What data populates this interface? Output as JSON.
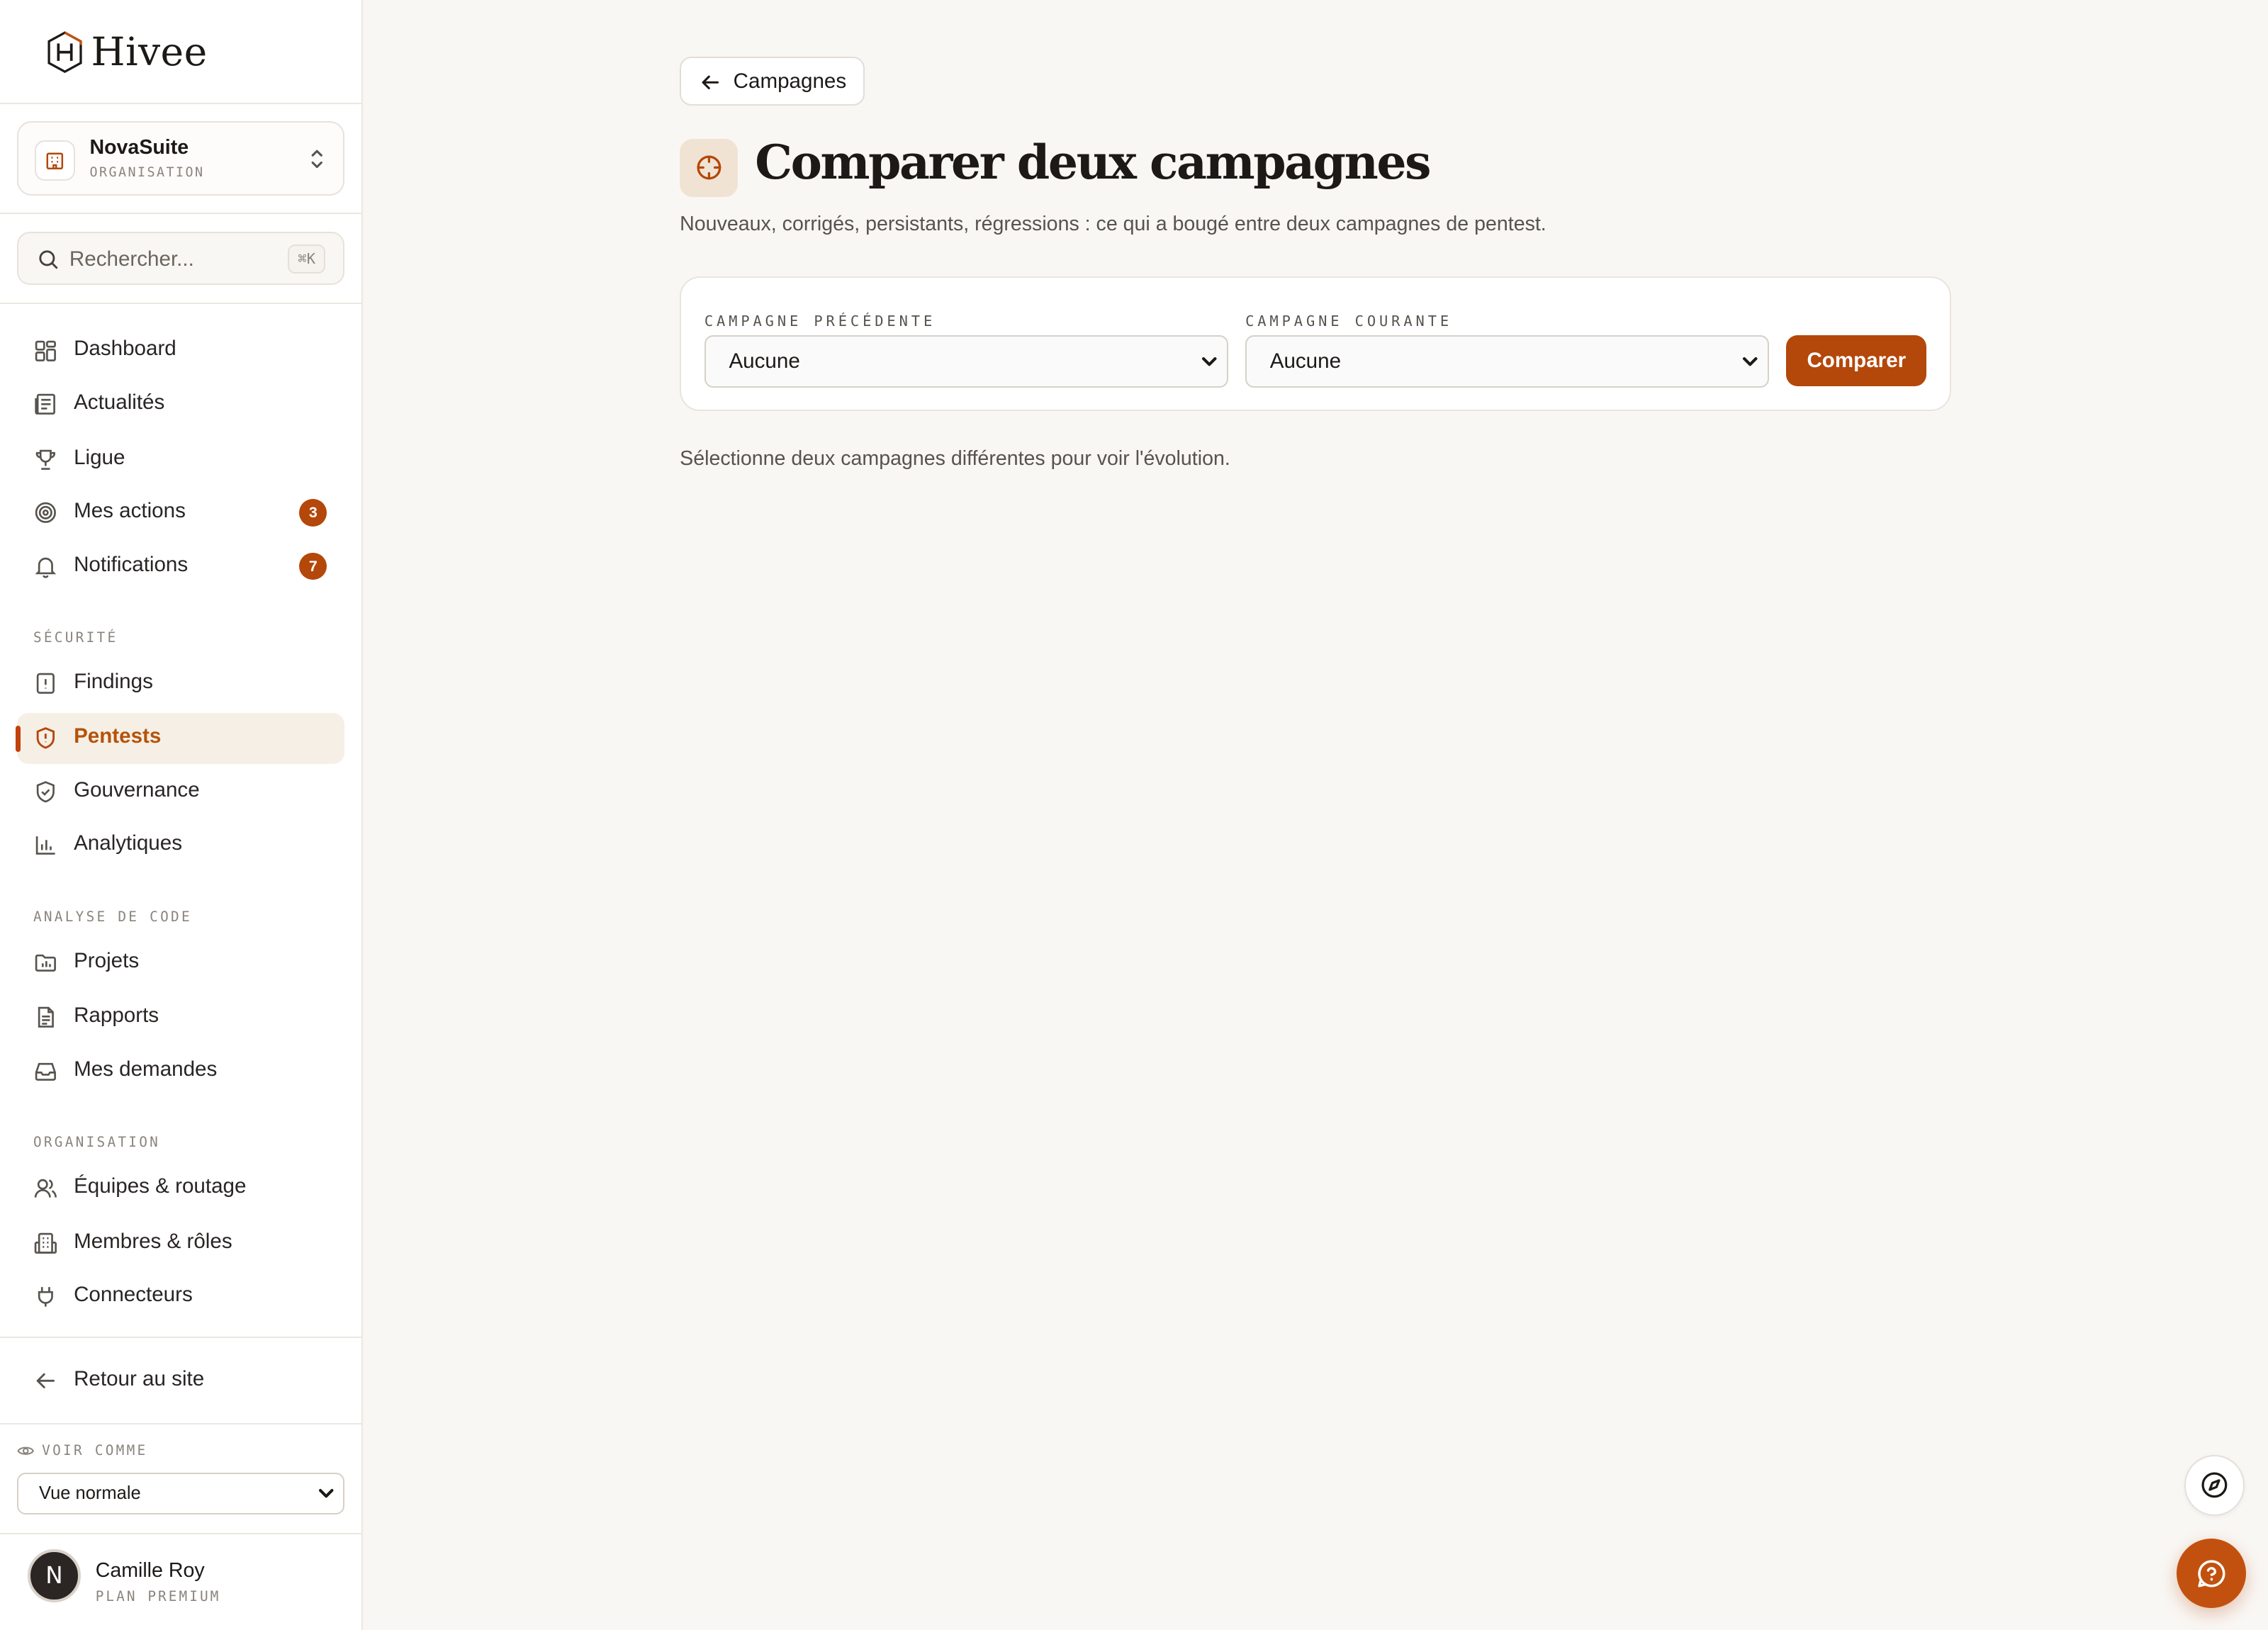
{
  "brand": {
    "name": "Hivee",
    "accent": "#b4470a"
  },
  "org": {
    "name": "NovaSuite",
    "type": "ORGANISATION"
  },
  "search": {
    "placeholder": "Rechercher...",
    "shortcut": "⌘K"
  },
  "nav": {
    "main": [
      {
        "label": "Dashboard",
        "icon": "dashboard-icon"
      },
      {
        "label": "Actualités",
        "icon": "newspaper-icon"
      },
      {
        "label": "Ligue",
        "icon": "trophy-icon"
      },
      {
        "label": "Mes actions",
        "icon": "target-icon",
        "badge": "3"
      },
      {
        "label": "Notifications",
        "icon": "bell-icon",
        "badge": "7"
      }
    ],
    "securite_label": "SÉCURITÉ",
    "securite": [
      {
        "label": "Findings",
        "icon": "alert-file-icon"
      },
      {
        "label": "Pentests",
        "icon": "shield-alert-icon",
        "active": true
      },
      {
        "label": "Gouvernance",
        "icon": "shield-check-icon"
      },
      {
        "label": "Analytiques",
        "icon": "bar-chart-icon"
      }
    ],
    "code_label": "ANALYSE DE CODE",
    "code": [
      {
        "label": "Projets",
        "icon": "folder-chart-icon"
      },
      {
        "label": "Rapports",
        "icon": "document-icon"
      },
      {
        "label": "Mes demandes",
        "icon": "inbox-icon"
      }
    ],
    "org_label": "ORGANISATION",
    "organisation": [
      {
        "label": "Équipes & routage",
        "icon": "users-icon"
      },
      {
        "label": "Membres & rôles",
        "icon": "building-icon"
      },
      {
        "label": "Connecteurs",
        "icon": "plug-icon"
      }
    ],
    "back": {
      "label": "Retour au site",
      "icon": "arrow-left-icon"
    }
  },
  "view_as": {
    "label": "VOIR COMME",
    "value": "Vue normale"
  },
  "user": {
    "initial": "N",
    "name": "Camille Roy",
    "plan": "PLAN PREMIUM"
  },
  "main": {
    "back_label": "Campagnes",
    "title": "Comparer deux campagnes",
    "subtitle": "Nouveaux, corrigés, persistants, régressions : ce qui a bougé entre deux campagnes de pentest.",
    "previous_label": "CAMPAGNE PRÉCÉDENTE",
    "previous_value": "Aucune",
    "current_label": "CAMPAGNE COURANTE",
    "current_value": "Aucune",
    "compare_label": "Comparer",
    "empty_message": "Sélectionne deux campagnes différentes pour voir l'évolution."
  }
}
